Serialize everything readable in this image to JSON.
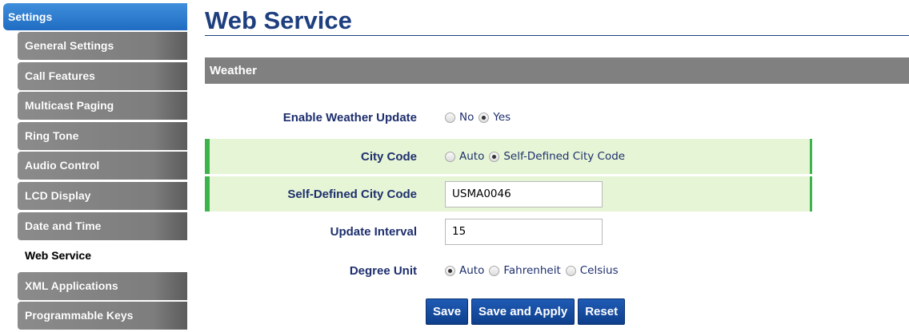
{
  "sidebar": {
    "header": "Settings",
    "items": [
      {
        "label": "General Settings"
      },
      {
        "label": "Call Features"
      },
      {
        "label": "Multicast Paging"
      },
      {
        "label": "Ring Tone"
      },
      {
        "label": "Audio Control"
      },
      {
        "label": "LCD Display"
      },
      {
        "label": "Date and Time"
      },
      {
        "label": "Web Service",
        "active": true
      },
      {
        "label": "XML Applications"
      },
      {
        "label": "Programmable Keys"
      }
    ]
  },
  "page": {
    "title": "Web Service",
    "section": "Weather"
  },
  "form": {
    "enable_weather": {
      "label": "Enable Weather Update",
      "options": [
        "No",
        "Yes"
      ],
      "selected": "Yes"
    },
    "city_code": {
      "label": "City Code",
      "options": [
        "Auto",
        "Self-Defined City Code"
      ],
      "selected": "Self-Defined City Code"
    },
    "self_defined_city_code": {
      "label": "Self-Defined City Code",
      "value": "USMA0046"
    },
    "update_interval": {
      "label": "Update Interval",
      "value": "15"
    },
    "degree_unit": {
      "label": "Degree Unit",
      "options": [
        "Auto",
        "Fahrenheit",
        "Celsius"
      ],
      "selected": "Auto"
    }
  },
  "buttons": {
    "save": "Save",
    "save_apply": "Save and Apply",
    "reset": "Reset"
  },
  "colors": {
    "title": "#1e3f7f",
    "sidebar_header": "#2a78cf",
    "sidebar_item": "#808080",
    "section_bar": "#808080",
    "highlight_row": "#e6f5d5",
    "highlight_border": "#3cb44b",
    "button": "#164c9e"
  }
}
